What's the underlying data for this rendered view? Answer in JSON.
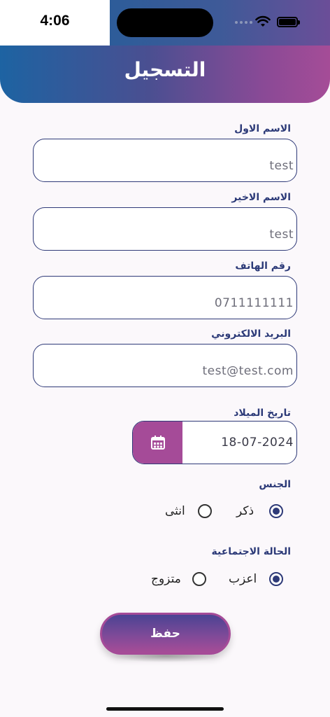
{
  "status_bar": {
    "time": "4:06"
  },
  "header": {
    "title": "التسجيل"
  },
  "fields": [
    {
      "label": "الاسم الاول",
      "value": "test"
    },
    {
      "label": "الاسم الاخير",
      "value": "test"
    },
    {
      "label": "رقم الهاتف",
      "value": "0711111111"
    },
    {
      "label": "البريد الالكتروني",
      "value": "test@test.com"
    }
  ],
  "birthdate": {
    "label": "تاريخ الميلاد",
    "value": "18-07-2024",
    "icon": "calendar-icon"
  },
  "gender": {
    "label": "الجنس",
    "options": [
      {
        "label": "ذكر",
        "checked": true
      },
      {
        "label": "انثى",
        "checked": false
      }
    ]
  },
  "marital": {
    "label": "الحالة الاجتماعية",
    "options": [
      {
        "label": "اعزب",
        "checked": true
      },
      {
        "label": "متزوج",
        "checked": false
      }
    ]
  },
  "save_button": {
    "label": "حفظ"
  },
  "colors": {
    "header_start": "#1d63a2",
    "header_end": "#a54c97",
    "accent": "#a54b98",
    "primary": "#2e3a78"
  }
}
